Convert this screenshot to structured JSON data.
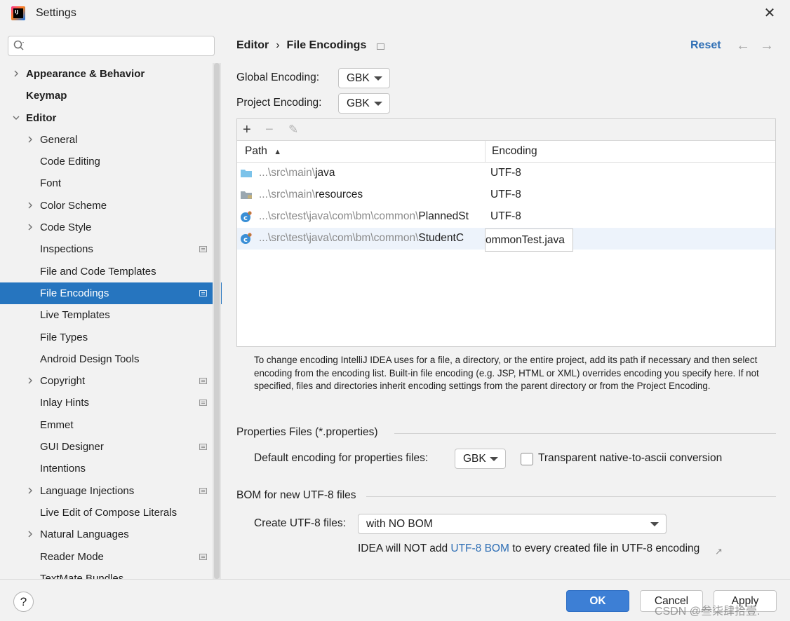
{
  "window": {
    "title": "Settings",
    "app_icon_text": "IJ"
  },
  "sidebar": {
    "search_placeholder": "",
    "items": [
      {
        "label": "Appearance & Behavior",
        "level": 0,
        "expander": "collapsed",
        "bold": true,
        "pin": false,
        "selected": false
      },
      {
        "label": "Keymap",
        "level": 0,
        "expander": "none",
        "bold": true,
        "pin": false,
        "selected": false
      },
      {
        "label": "Editor",
        "level": 0,
        "expander": "expanded",
        "bold": true,
        "pin": false,
        "selected": false
      },
      {
        "label": "General",
        "level": 1,
        "expander": "collapsed",
        "bold": false,
        "pin": false,
        "selected": false
      },
      {
        "label": "Code Editing",
        "level": 1,
        "expander": "none",
        "bold": false,
        "pin": false,
        "selected": false
      },
      {
        "label": "Font",
        "level": 1,
        "expander": "none",
        "bold": false,
        "pin": false,
        "selected": false
      },
      {
        "label": "Color Scheme",
        "level": 1,
        "expander": "collapsed",
        "bold": false,
        "pin": false,
        "selected": false
      },
      {
        "label": "Code Style",
        "level": 1,
        "expander": "collapsed",
        "bold": false,
        "pin": false,
        "selected": false
      },
      {
        "label": "Inspections",
        "level": 1,
        "expander": "none",
        "bold": false,
        "pin": true,
        "selected": false
      },
      {
        "label": "File and Code Templates",
        "level": 1,
        "expander": "none",
        "bold": false,
        "pin": false,
        "selected": false
      },
      {
        "label": "File Encodings",
        "level": 1,
        "expander": "none",
        "bold": false,
        "pin": true,
        "selected": true
      },
      {
        "label": "Live Templates",
        "level": 1,
        "expander": "none",
        "bold": false,
        "pin": false,
        "selected": false
      },
      {
        "label": "File Types",
        "level": 1,
        "expander": "none",
        "bold": false,
        "pin": false,
        "selected": false
      },
      {
        "label": "Android Design Tools",
        "level": 1,
        "expander": "none",
        "bold": false,
        "pin": false,
        "selected": false
      },
      {
        "label": "Copyright",
        "level": 1,
        "expander": "collapsed",
        "bold": false,
        "pin": true,
        "selected": false
      },
      {
        "label": "Inlay Hints",
        "level": 1,
        "expander": "none",
        "bold": false,
        "pin": true,
        "selected": false
      },
      {
        "label": "Emmet",
        "level": 1,
        "expander": "none",
        "bold": false,
        "pin": false,
        "selected": false
      },
      {
        "label": "GUI Designer",
        "level": 1,
        "expander": "none",
        "bold": false,
        "pin": true,
        "selected": false
      },
      {
        "label": "Intentions",
        "level": 1,
        "expander": "none",
        "bold": false,
        "pin": false,
        "selected": false
      },
      {
        "label": "Language Injections",
        "level": 1,
        "expander": "collapsed",
        "bold": false,
        "pin": true,
        "selected": false
      },
      {
        "label": "Live Edit of Compose Literals",
        "level": 1,
        "expander": "none",
        "bold": false,
        "pin": false,
        "selected": false
      },
      {
        "label": "Natural Languages",
        "level": 1,
        "expander": "collapsed",
        "bold": false,
        "pin": false,
        "selected": false
      },
      {
        "label": "Reader Mode",
        "level": 1,
        "expander": "none",
        "bold": false,
        "pin": true,
        "selected": false
      },
      {
        "label": "TextMate Bundles",
        "level": 1,
        "expander": "none",
        "bold": false,
        "pin": false,
        "selected": false
      }
    ]
  },
  "header": {
    "crumb_parent": "Editor",
    "crumb_separator": "›",
    "crumb_current": "File Encodings",
    "reset": "Reset",
    "back_arrow": "←",
    "forward_arrow": "→"
  },
  "global_encoding": {
    "label": "Global Encoding:",
    "value": "GBK"
  },
  "project_encoding": {
    "label": "Project Encoding:",
    "value": "GBK"
  },
  "table": {
    "toolbar": {
      "add": "+",
      "remove": "−",
      "edit": "✎"
    },
    "columns": [
      "Path",
      "Encoding"
    ],
    "sort_indicator": "▲",
    "rows": [
      {
        "path_dim": "...\\src\\main\\",
        "path_name": "java",
        "encoding": "UTF-8",
        "icon": "source-folder-icon"
      },
      {
        "path_dim": "...\\src\\main\\",
        "path_name": "resources",
        "encoding": "UTF-8",
        "icon": "resources-folder-icon"
      },
      {
        "path_dim": "...\\src\\test\\java\\com\\bm\\common\\",
        "path_name": "PlannedSt",
        "encoding": "UTF-8",
        "icon": "test-class-icon"
      },
      {
        "path_dim": "...\\src\\test\\java\\com\\bm\\common\\",
        "path_name": "StudentC",
        "encoding": "",
        "icon": "test-class-icon"
      }
    ],
    "tooltip": "ommonTest.java"
  },
  "help_text": "To change encoding IntelliJ IDEA uses for a file, a directory, or the entire project, add its path if necessary and then select encoding from the encoding list. Built-in file encoding (e.g. JSP, HTML or XML) overrides encoding you specify here. If not specified, files and directories inherit encoding settings from the parent directory or from the Project Encoding.",
  "properties": {
    "section_title": "Properties Files (*.properties)",
    "default_label": "Default encoding for properties files:",
    "default_value": "GBK",
    "transparent_label": "Transparent native-to-ascii conversion",
    "transparent_checked": false
  },
  "bom": {
    "section_title": "BOM for new UTF-8 files",
    "create_label": "Create UTF-8 files:",
    "create_value": "with NO BOM",
    "note_prefix": "IDEA will NOT add ",
    "note_link": "UTF-8 BOM",
    "note_suffix": " to every created file in UTF-8 encoding",
    "note_icon": "↗"
  },
  "footer": {
    "help": "?",
    "ok": "OK",
    "cancel": "Cancel",
    "apply": "Apply",
    "watermark": "CSDN @叁柒肆拾壹."
  },
  "colors": {
    "selection": "#2675bf",
    "link": "#2f6fb5",
    "ok_button": "#3d7fd5"
  }
}
